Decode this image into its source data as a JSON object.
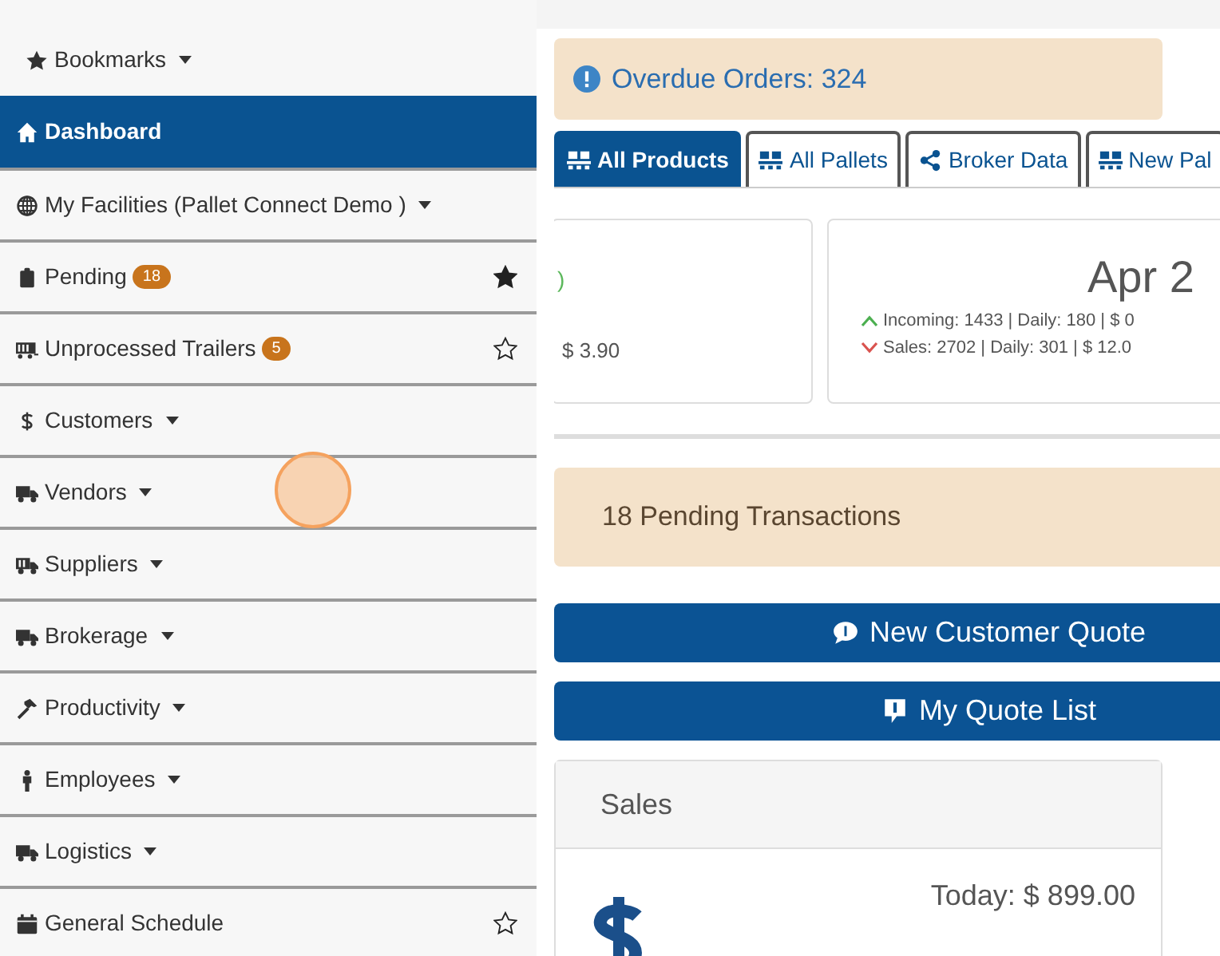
{
  "sidebar": {
    "items": [
      {
        "label": "Bookmarks",
        "selected": false,
        "dropdown": true
      },
      {
        "label": "Dashboard",
        "selected": true,
        "dropdown": false
      },
      {
        "label": "My Facilities (Pallet Connect Demo )",
        "selected": false,
        "dropdown": true
      },
      {
        "label": "Pending",
        "selected": false,
        "dropdown": false,
        "badge": "18",
        "starred": true
      },
      {
        "label": "Unprocessed Trailers",
        "selected": false,
        "dropdown": false,
        "badge": "5",
        "starred": false
      },
      {
        "label": "Customers",
        "selected": false,
        "dropdown": true
      },
      {
        "label": "Vendors",
        "selected": false,
        "dropdown": true
      },
      {
        "label": "Suppliers",
        "selected": false,
        "dropdown": true
      },
      {
        "label": "Brokerage",
        "selected": false,
        "dropdown": true
      },
      {
        "label": "Productivity",
        "selected": false,
        "dropdown": true
      },
      {
        "label": "Employees",
        "selected": false,
        "dropdown": true
      },
      {
        "label": "Logistics",
        "selected": false,
        "dropdown": true
      },
      {
        "label": "General Schedule",
        "selected": false,
        "dropdown": false,
        "starred": false
      }
    ]
  },
  "alert": {
    "text": "Overdue Orders: 324"
  },
  "tabs": [
    {
      "label": "All Products",
      "selected": true
    },
    {
      "label": "All Pallets",
      "selected": false
    },
    {
      "label": "Broker Data",
      "selected": false
    },
    {
      "label": "New Pal",
      "selected": false
    }
  ],
  "cards": [
    {
      "lines": [
        ")",
        "$ 3.90"
      ]
    },
    {
      "title": "Apr 2",
      "incoming": "Incoming: 1433 | Daily: 180 | $ 0",
      "sales": "Sales: 2702 | Daily: 301 | $ 12.0"
    }
  ],
  "pending_notice": {
    "text": "18 Pending Transactions"
  },
  "buttons": [
    "New Customer Quote",
    "My Quote List"
  ],
  "sales_panel": {
    "title": "Sales",
    "today": "Today: $ 899.00"
  }
}
